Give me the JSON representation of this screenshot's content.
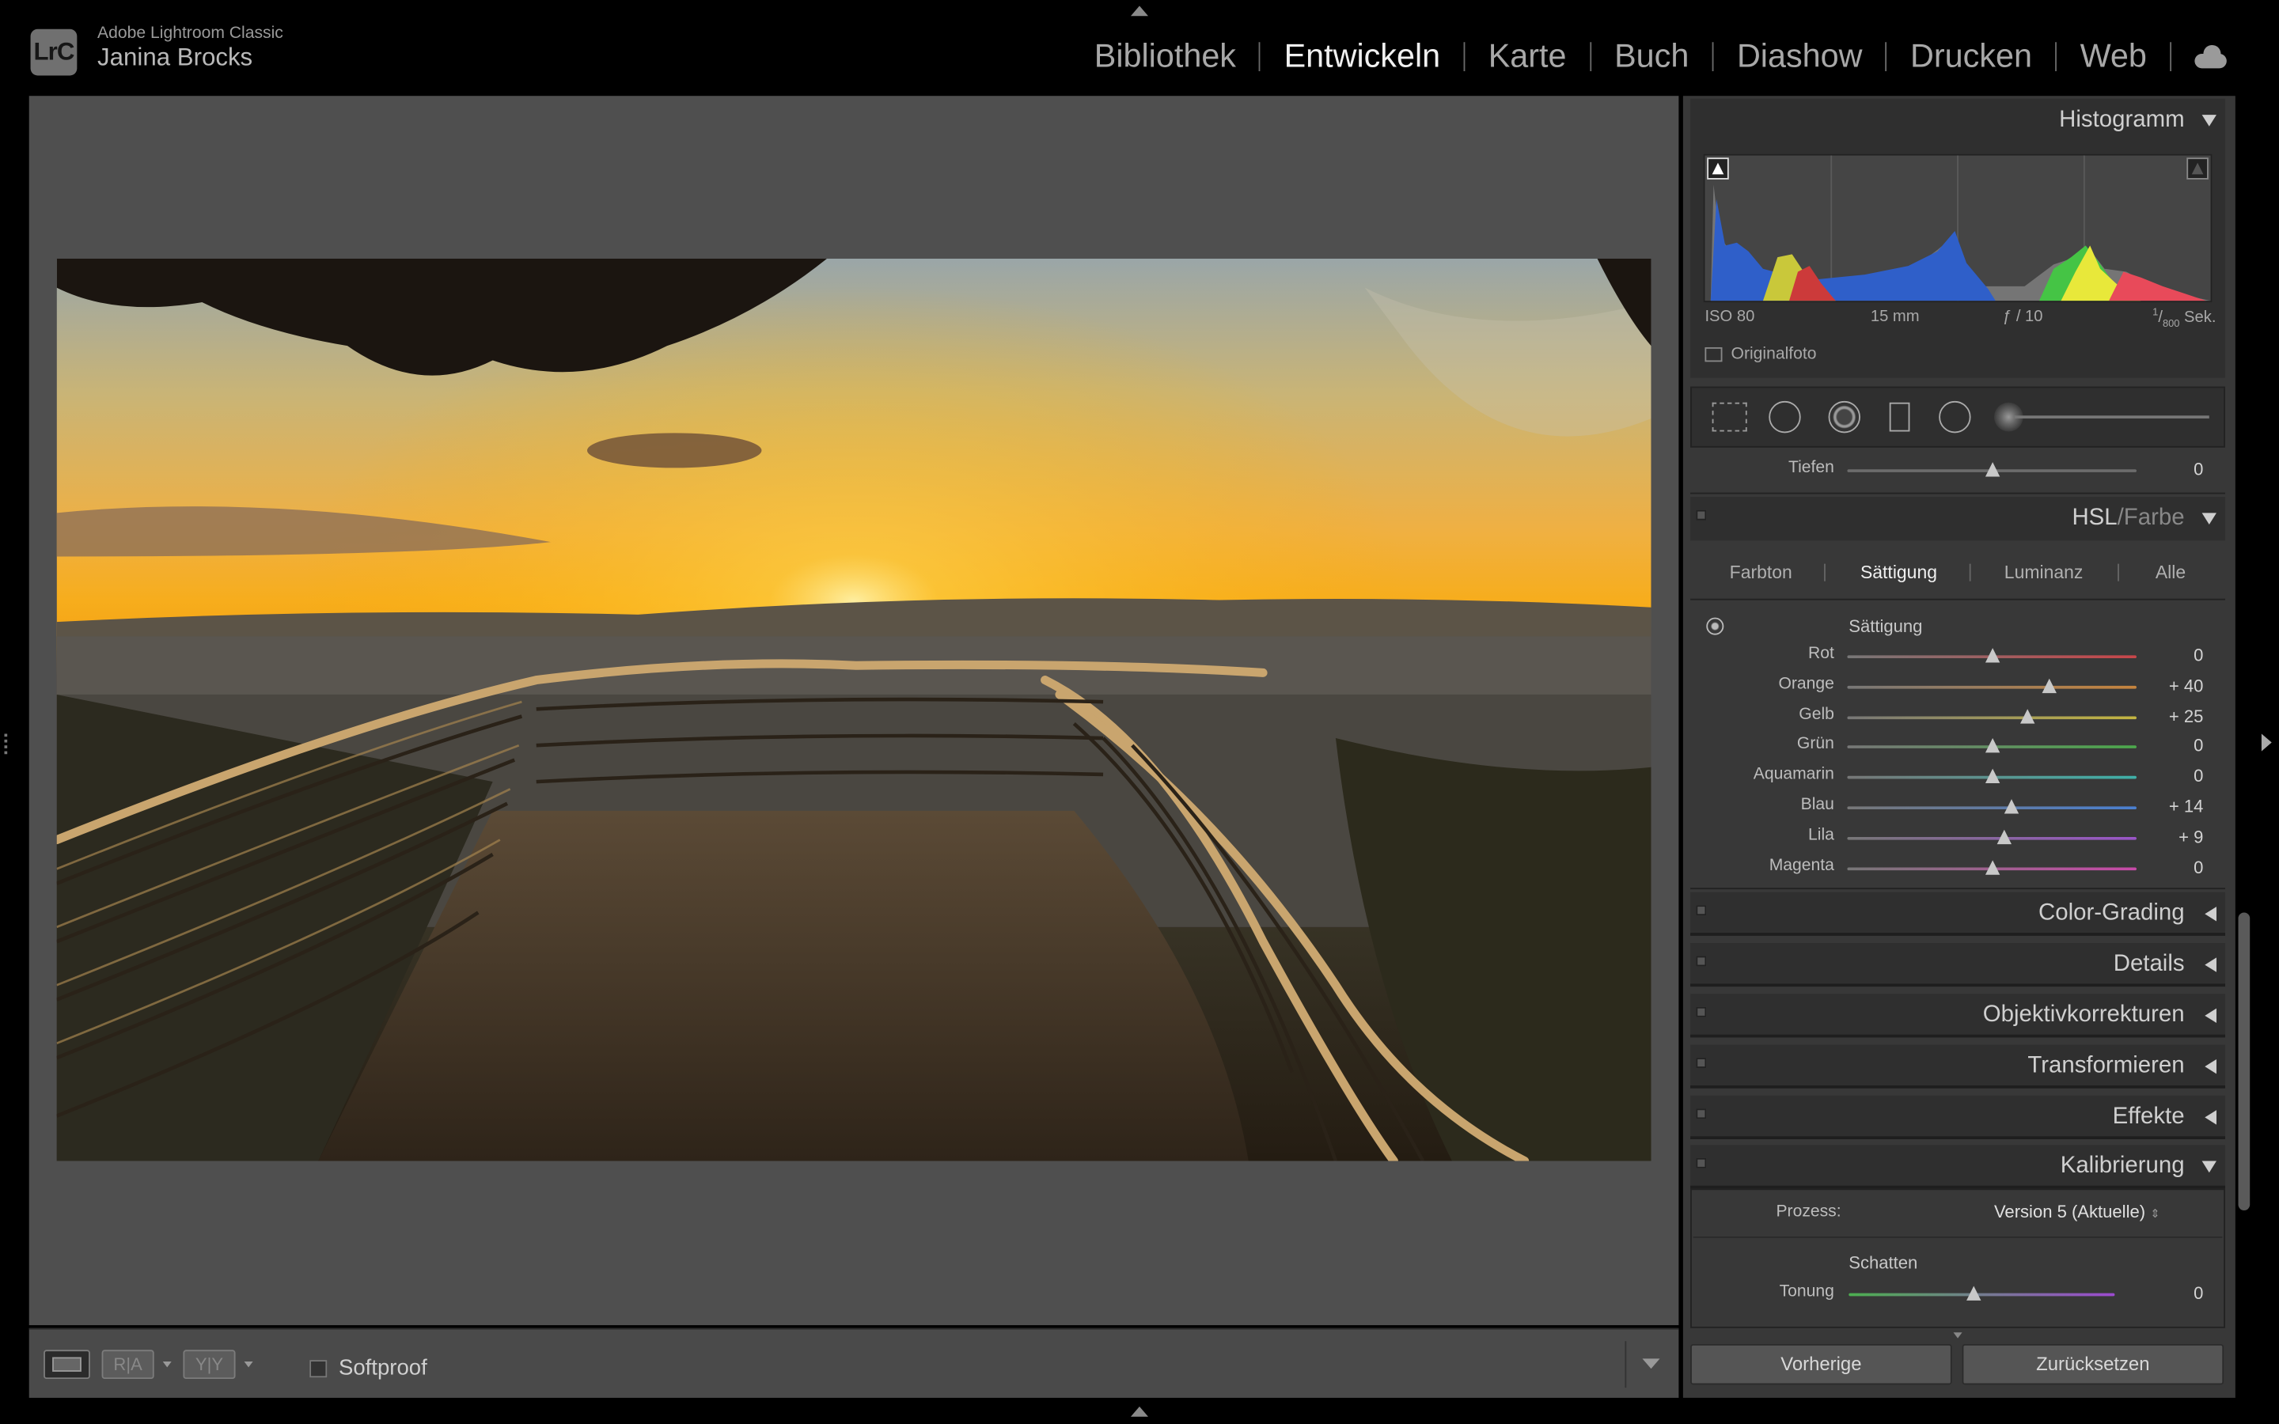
{
  "app": {
    "logo": "LrC",
    "name": "Adobe Lightroom Classic",
    "user": "Janina Brocks"
  },
  "modules": [
    "Bibliothek",
    "Entwickeln",
    "Karte",
    "Buch",
    "Diashow",
    "Drucken",
    "Web"
  ],
  "active_module": "Entwickeln",
  "toolbar": {
    "softproof": "Softproof",
    "view_icons": [
      "loupe-view-icon",
      "before-after-icon",
      "before-after-split-icon"
    ]
  },
  "histogram": {
    "title": "Histogramm",
    "iso": "ISO 80",
    "focal": "15 mm",
    "aperture": "ƒ / 10",
    "shutter_num": "1",
    "shutter_den": "800",
    "shutter_unit": "Sek.",
    "original_label": "Originalfoto"
  },
  "tools": [
    "crop-icon",
    "spot-removal-icon",
    "redeye-icon",
    "graduated-filter-icon",
    "radial-filter-icon",
    "brush-icon"
  ],
  "tone": {
    "label": "Tiefen",
    "value": "0",
    "position": 0.5
  },
  "hsl": {
    "title_a": "HSL",
    "title_sep": "/",
    "title_b": "Farbe",
    "tabs": [
      "Farbton",
      "Sättigung",
      "Luminanz",
      "Alle"
    ],
    "active_tab": "Sättigung",
    "section": "Sättigung",
    "sliders": [
      {
        "label": "Rot",
        "value": "0",
        "position": 0.5,
        "color": "#c8464a"
      },
      {
        "label": "Orange",
        "value": "+ 40",
        "position": 0.7,
        "color": "#c6843e"
      },
      {
        "label": "Gelb",
        "value": "+ 25",
        "position": 0.625,
        "color": "#c4b541"
      },
      {
        "label": "Grün",
        "value": "0",
        "position": 0.5,
        "color": "#4ca84c"
      },
      {
        "label": "Aquamarin",
        "value": "0",
        "position": 0.5,
        "color": "#3fb0a8"
      },
      {
        "label": "Blau",
        "value": "+ 14",
        "position": 0.57,
        "color": "#4a7fd0"
      },
      {
        "label": "Lila",
        "value": "+ 9",
        "position": 0.545,
        "color": "#9a55c8"
      },
      {
        "label": "Magenta",
        "value": "0",
        "position": 0.5,
        "color": "#c84aa8"
      }
    ]
  },
  "panels": [
    {
      "title": "Color-Grading",
      "state": "collapsed"
    },
    {
      "title": "Details",
      "state": "collapsed"
    },
    {
      "title": "Objektivkorrekturen",
      "state": "collapsed"
    },
    {
      "title": "Transformieren",
      "state": "collapsed"
    },
    {
      "title": "Effekte",
      "state": "collapsed"
    },
    {
      "title": "Kalibrierung",
      "state": "expanded"
    }
  ],
  "calibration": {
    "process_label": "Prozess:",
    "process_value": "Version 5 (Aktuelle)",
    "shadows_label": "Schatten",
    "tint_label": "Tonung",
    "tint_value": "0",
    "tint_position": 0.47
  },
  "buttons": {
    "previous": "Vorherige",
    "reset": "Zurücksetzen"
  }
}
